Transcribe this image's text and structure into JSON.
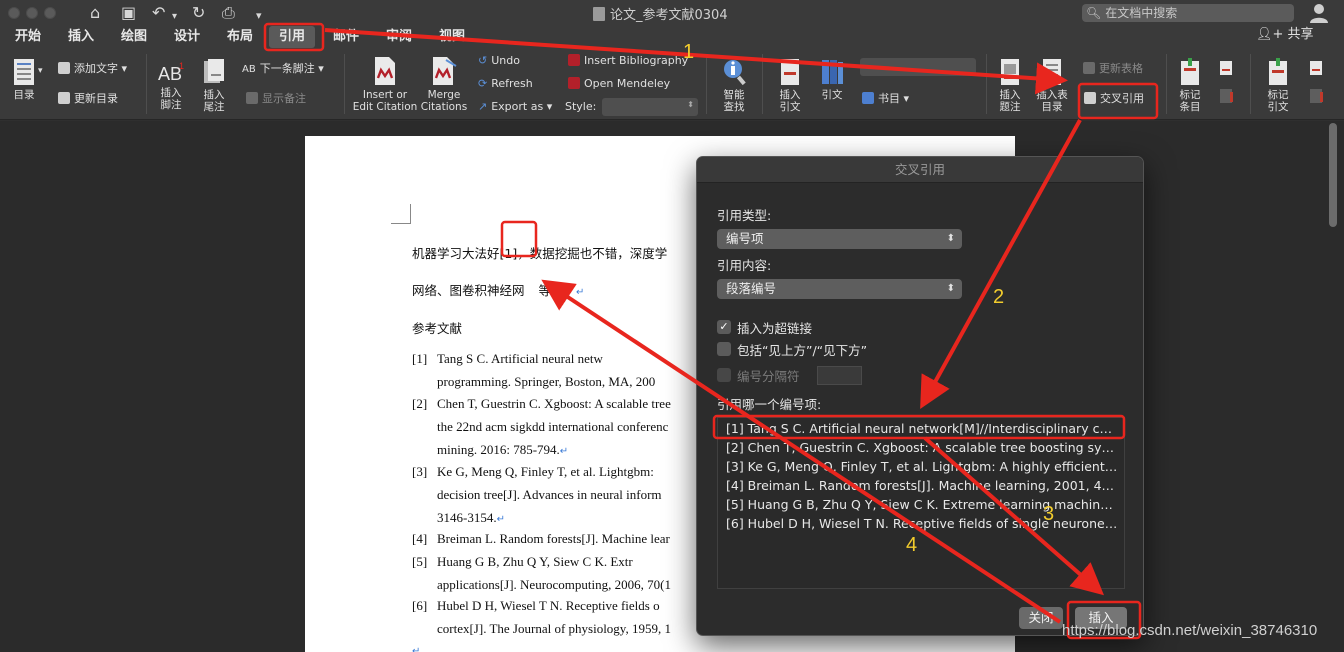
{
  "window": {
    "title": "论文_参考文献0304",
    "search_placeholder": "在文档中搜索"
  },
  "tabs": [
    {
      "label": "开始"
    },
    {
      "label": "插入"
    },
    {
      "label": "绘图"
    },
    {
      "label": "设计"
    },
    {
      "label": "布局"
    },
    {
      "label": "引用",
      "active": true
    },
    {
      "label": "邮件"
    },
    {
      "label": "审阅"
    },
    {
      "label": "视图"
    }
  ],
  "share_label": "共享",
  "ribbon": {
    "toc": "目录",
    "add_text": "添加文字",
    "update_toc": "更新目录",
    "insert_footnote": "插入\n脚注",
    "insert_endnote": "插入\n尾注",
    "next_footnote": "下一条脚注",
    "show_notes": "显示备注",
    "insert_citation": "Insert or\nEdit Citation",
    "merge_citations": "Merge\nCitations",
    "undo": "Undo",
    "refresh": "Refresh",
    "export_as": "Export as",
    "insert_bibliography": "Insert Bibliography",
    "open_mendeley": "Open Mendeley",
    "style_label": "Style:",
    "smart_lookup": "智能\n查找",
    "insert_citation_cn": "插入\n引文",
    "citation": "引文",
    "bibliography": "书目",
    "insert_caption": "插入\n题注",
    "insert_table_of_figures": "插入表\n目录",
    "update_table": "更新表格",
    "cross_reference": "交叉引用",
    "mark_entry": "标记\n条目",
    "mark_citation": "标记\n引文"
  },
  "document": {
    "line1": "机器学习大法好[1]，数据挖掘也不错，深度学",
    "line2": "网络、图卷积神经网",
    "line2b": "等等。",
    "refs_heading": "参考文献",
    "references": [
      {
        "num": "[1]",
        "lines": [
          "Tang S C. Artificial neural netw",
          "programming. Springer, Boston, MA, 200"
        ]
      },
      {
        "num": "[2]",
        "lines": [
          "Chen T, Guestrin C. Xgboost: A scalable tree",
          "the 22nd acm sigkdd international conferenc",
          "mining. 2016: 785-794."
        ]
      },
      {
        "num": "[3]",
        "lines": [
          "Ke G, Meng Q, Finley T, et al. Lightgbm:",
          "decision tree[J]. Advances in neural inform",
          "3146-3154."
        ]
      },
      {
        "num": "[4]",
        "lines": [
          "Breiman L. Random forests[J]. Machine lear"
        ]
      },
      {
        "num": "[5]",
        "lines": [
          "Huang G B, Zhu Q Y, Siew C K. Extr",
          "applications[J]. Neurocomputing, 2006, 70(1"
        ]
      },
      {
        "num": "[6]",
        "lines": [
          "Hubel D H, Wiesel T N. Receptive fields o",
          "cortex[J]. The Journal of physiology, 1959, 1"
        ]
      }
    ]
  },
  "dialog": {
    "title": "交叉引用",
    "ref_type_label": "引用类型:",
    "ref_type_value": "编号项",
    "ref_content_label": "引用内容:",
    "ref_content_value": "段落编号",
    "insert_hyperlink": "插入为超链接",
    "include_above_below": "包括“见上方”/“见下方”",
    "number_separator": "编号分隔符",
    "which_item_label": "引用哪一个编号项:",
    "items": [
      "[1] Tang S C. Artificial neural network[M]//Interdisciplinary com...",
      "[2] Chen T, Guestrin C. Xgboost: A scalable tree boosting syst...",
      "[3] Ke G, Meng Q, Finley T, et al. Lightgbm: A highly efficient g...",
      "[4] Breiman L. Random forests[J]. Machine learning, 2001, 45(...",
      "[5] Huang G B, Zhu Q Y, Siew C K. Extreme learning machine: t...",
      "[6] Hubel D H, Wiesel T N. Receptive fields of single neurones ..."
    ],
    "close_btn": "关闭",
    "insert_btn": "插入"
  },
  "annotations": {
    "step1": "1",
    "step2": "2",
    "step3": "3",
    "step4": "4",
    "arrow_color": "#e8261e",
    "label_color": "#f2cc2d"
  },
  "watermark": "https://blog.csdn.net/weixin_38746310"
}
